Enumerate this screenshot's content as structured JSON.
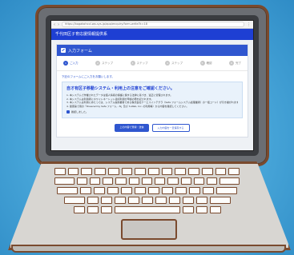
{
  "browser": {
    "url": "https://bogakohcol.wp-sys.jp/app/enquiry/form-write?k=18",
    "nav_back": "‹",
    "nav_forward": "›",
    "menu": "⋮"
  },
  "site": {
    "title": "千代田区子育応援情報提供系"
  },
  "form": {
    "header": "入力フォーム",
    "steps": [
      {
        "num": "1",
        "label": "ご入力"
      },
      {
        "num": "2",
        "label": "ステップ"
      },
      {
        "num": "3",
        "label": "ステップ"
      },
      {
        "num": "4",
        "label": "ステップ"
      },
      {
        "num": "5",
        "label": "確認"
      },
      {
        "num": "6",
        "label": "完了"
      }
    ],
    "lead": "下記のフォームにご入力をお願いします。",
    "notice_title": "自オ有区子移動システム・利用上の注意をご確認ください。",
    "notice_lines": [
      "1. 本システムで作業されたデータは個人情報の保護に関する法律に基づき、適正に管理されます。",
      "2. 本システムは利用者にホワイトネートット適切利用が申請の際を記されます。",
      "3. 本システムは利用にあたっては、システム提供業者である株式会社ケーエスインテグラ（Safe フォームシステム処理業者）の一括コード）が引き継がれます。",
      "4. 健康第で用の「Powered by Safe フォーム - N」及び S-Web, Inc. の利用等）から内容を確認してください。"
    ],
    "agree_label": "確認しました。",
    "btn_primary": "上の内容で登録・送信",
    "btn_secondary": "入力内容を一旦保存する"
  }
}
